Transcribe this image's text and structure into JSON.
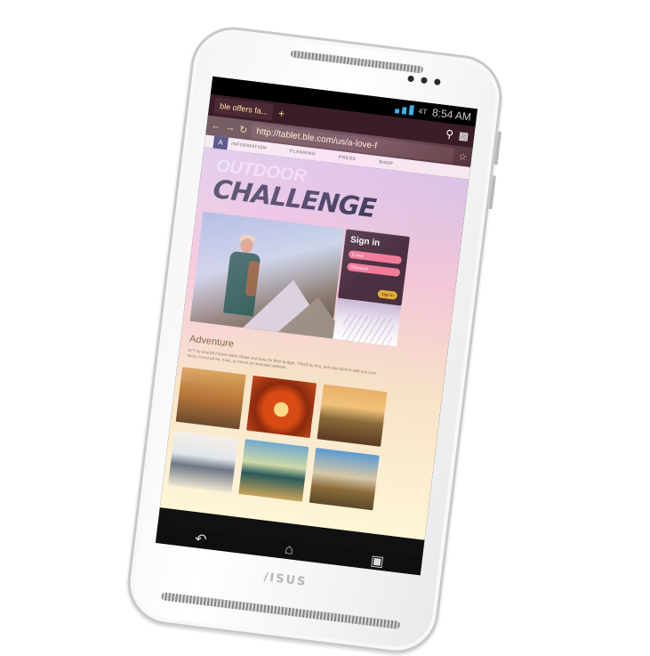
{
  "device": {
    "brand_logo": "/ISUS"
  },
  "status_bar": {
    "time": "8:54 AM",
    "network_label": "4T"
  },
  "browser": {
    "tab_title": "ble offers fa...",
    "new_tab_symbol": "+",
    "url": "http://tablet.ble.com/us/a-love-f"
  },
  "site_nav": {
    "logo": "A",
    "items": [
      "INFORMATION",
      "PLANNING",
      "PRESS",
      "SHOP"
    ]
  },
  "hero": {
    "title": "CHALLENGE",
    "faded_title": "OUTDOOR"
  },
  "signin": {
    "title": "Sign in",
    "email_placeholder": "E-mail",
    "password_placeholder": "Password",
    "button": "Sign In"
  },
  "section": {
    "title": "Adventure",
    "text": "BTT ile beautiful three-sided shape and easy for their budget. They'll do fine, and take picture with you your ideas, travel photo, rules, or movie on mountain website."
  },
  "thumbnails": [
    "desert-camels",
    "red-rock-arch",
    "cracked-earth-sunset",
    "mountain-lake",
    "autumn-lake",
    "castle-ruins"
  ],
  "colors": {
    "browser_bar": "#4a2a30",
    "signin_panel": "#4a3040",
    "field": "#f27b9a",
    "button": "#e4b03a"
  }
}
